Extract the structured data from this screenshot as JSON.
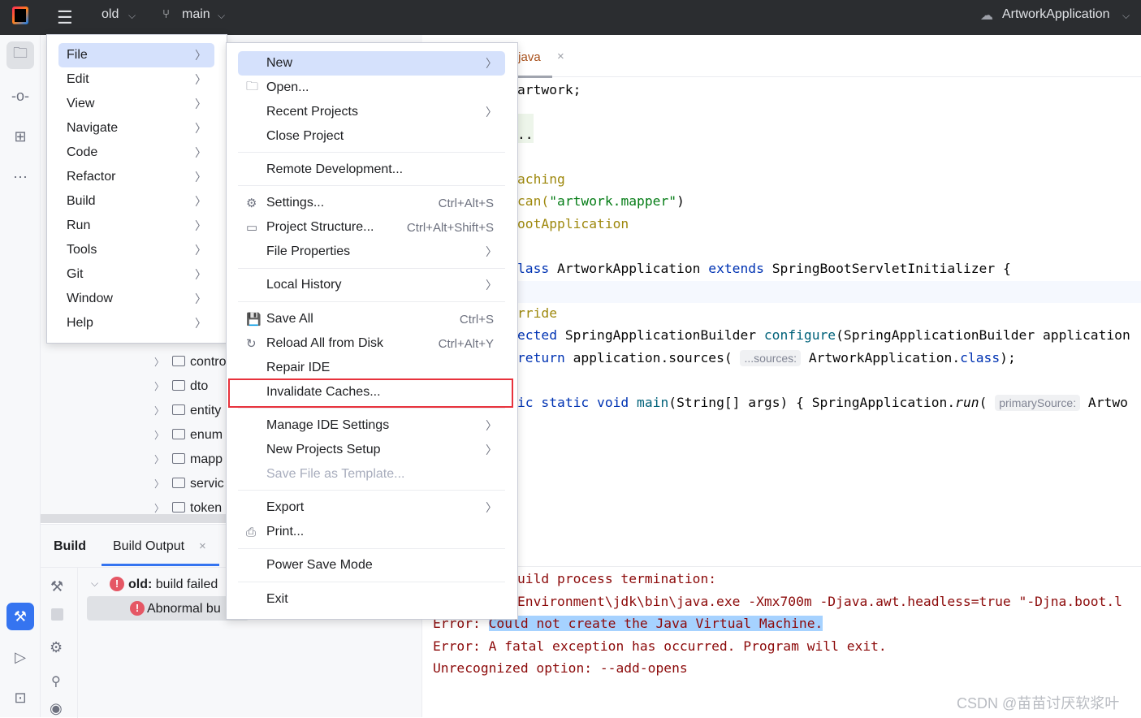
{
  "topbar": {
    "project": "old",
    "branch": "main",
    "run_config": "ArtworkApplication"
  },
  "main_menu": [
    "File",
    "Edit",
    "View",
    "Navigate",
    "Code",
    "Refactor",
    "Build",
    "Run",
    "Tools",
    "Git",
    "Window",
    "Help"
  ],
  "file_menu": [
    {
      "label": "New",
      "arrow": true,
      "selected": true
    },
    {
      "label": "Open...",
      "icon": "folder-icon"
    },
    {
      "label": "Recent Projects",
      "arrow": true
    },
    {
      "label": "Close Project"
    },
    {
      "label": "Remote Development..."
    },
    {
      "label": "Settings...",
      "shortcut": "Ctrl+Alt+S",
      "icon": "gear-icon"
    },
    {
      "label": "Project Structure...",
      "shortcut": "Ctrl+Alt+Shift+S",
      "icon": "project-structure-icon"
    },
    {
      "label": "File Properties",
      "arrow": true
    },
    {
      "label": "Local History",
      "arrow": true
    },
    {
      "label": "Save All",
      "shortcut": "Ctrl+S",
      "icon": "save-icon"
    },
    {
      "label": "Reload All from Disk",
      "shortcut": "Ctrl+Alt+Y",
      "icon": "reload-icon"
    },
    {
      "label": "Repair IDE"
    },
    {
      "label": "Invalidate Caches...",
      "highlighted_box": true
    },
    {
      "label": "Manage IDE Settings",
      "arrow": true
    },
    {
      "label": "New Projects Setup",
      "arrow": true
    },
    {
      "label": "Save File as Template...",
      "disabled": true
    },
    {
      "label": "Export",
      "arrow": true
    },
    {
      "label": "Print...",
      "icon": "print-icon"
    },
    {
      "label": "Power Save Mode"
    },
    {
      "label": "Exit"
    }
  ],
  "project_tree": [
    "contro",
    "dto",
    "entity",
    "enum",
    "mapp",
    "servic",
    "token"
  ],
  "build": {
    "tab_build": "Build",
    "tab_output": "Build Output",
    "row1_bold": "old:",
    "row1": " build failed",
    "row2": "Abnormal bu"
  },
  "editor": {
    "tab": ".java",
    "lines": {
      "l1": "artwork;",
      "l2": "..",
      "l3": "aching",
      "l4a": "can(",
      "l4b": "\"artwork.mapper\"",
      "l4c": ")",
      "l5": "ootApplication",
      "l6a": "lass",
      "l6b": " ArtworkApplication ",
      "l6c": "extends",
      "l6d": " SpringBootServletInitializer {",
      "l7": "rride",
      "l8a": "ected",
      "l8b": " SpringApplicationBuilder ",
      "l8c": "configure",
      "l8d": "(SpringApplicationBuilder application",
      "l9a": "return",
      "l9b": " application.sources( ",
      "l9h": "...sources:",
      "l9c": " ArtworkApplication.",
      "l9d": "class",
      "l9e": ");",
      "l10a": "ic static void ",
      "l10b": "main",
      "l10c": "(String[] args) { SpringApplication.",
      "l10d": "run",
      "l10e": "( ",
      "l10h": "primarySource:",
      "l10f": " Artwo"
    }
  },
  "console": {
    "c1": "uild process termination:",
    "c2": "Environment\\jdk\\bin\\java.exe -Xmx700m -Djava.awt.headless=true \"-Djna.boot.l",
    "c3a": "Error: ",
    "c3b": "Could not create the Java Virtual Machine.",
    "c4": "Error: A fatal exception has occurred. Program will exit.",
    "c5": "Unrecognized option: --add-opens"
  },
  "watermark": "CSDN @苗苗讨厌软浆叶"
}
